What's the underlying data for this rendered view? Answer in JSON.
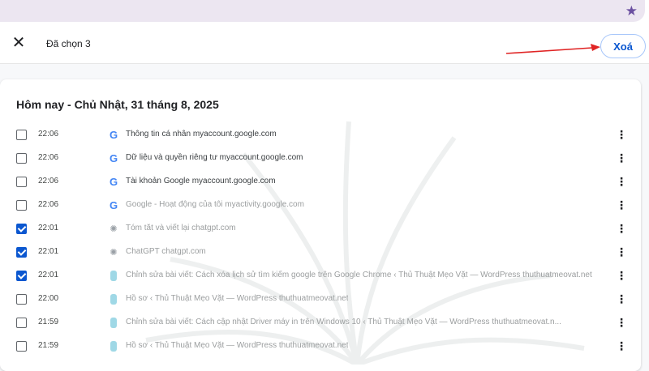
{
  "toolbar": {
    "star_icon": "star-icon"
  },
  "selection": {
    "count_label": "Đã chọn 3",
    "delete_label": "Xoá",
    "accent_color": "#0b57d0",
    "annotation_color": "#e02424"
  },
  "history": {
    "heading": "Hôm nay - Chủ Nhật, 31 tháng 8, 2025",
    "items": [
      {
        "time": "22:06",
        "checked": false,
        "favicon": "google-icon",
        "title": "Thông tin cá nhân   myaccount.google.com"
      },
      {
        "time": "22:06",
        "checked": false,
        "favicon": "google-icon",
        "title": "Dữ liệu và quyền riêng tư   myaccount.google.com"
      },
      {
        "time": "22:06",
        "checked": false,
        "favicon": "google-icon",
        "title": "Tài khoản Google   myaccount.google.com"
      },
      {
        "time": "22:06",
        "checked": false,
        "favicon": "google-icon",
        "title": "Google - Hoạt động của tôi   myactivity.google.com"
      },
      {
        "time": "22:01",
        "checked": true,
        "favicon": "chatgpt-icon",
        "title": "Tóm tắt và viết lại   chatgpt.com"
      },
      {
        "time": "22:01",
        "checked": true,
        "favicon": "chatgpt-icon",
        "title": "ChatGPT   chatgpt.com"
      },
      {
        "time": "22:01",
        "checked": true,
        "favicon": "wordpress-icon",
        "title": "Chỉnh sửa bài viết: Cách xóa lịch sử tìm kiếm google trên Google Chrome ‹ Thủ Thuật Mẹo Vặt — WordPress   thuthuatmeovat.net"
      },
      {
        "time": "22:00",
        "checked": false,
        "favicon": "wordpress-icon",
        "title": "Hồ sơ ‹ Thủ Thuật Mẹo Vặt — WordPress   thuthuatmeovat.net"
      },
      {
        "time": "21:59",
        "checked": false,
        "favicon": "wordpress-icon",
        "title": "Chỉnh sửa bài viết: Cách cập nhật Driver máy in trên Windows 10 ‹ Thủ Thuật Mẹo Vặt — WordPress   thuthuatmeovat.n..."
      },
      {
        "time": "21:59",
        "checked": false,
        "favicon": "wordpress-icon",
        "title": "Hồ sơ ‹ Thủ Thuật Mẹo Vặt — WordPress   thuthuatmeovat.net"
      }
    ]
  }
}
